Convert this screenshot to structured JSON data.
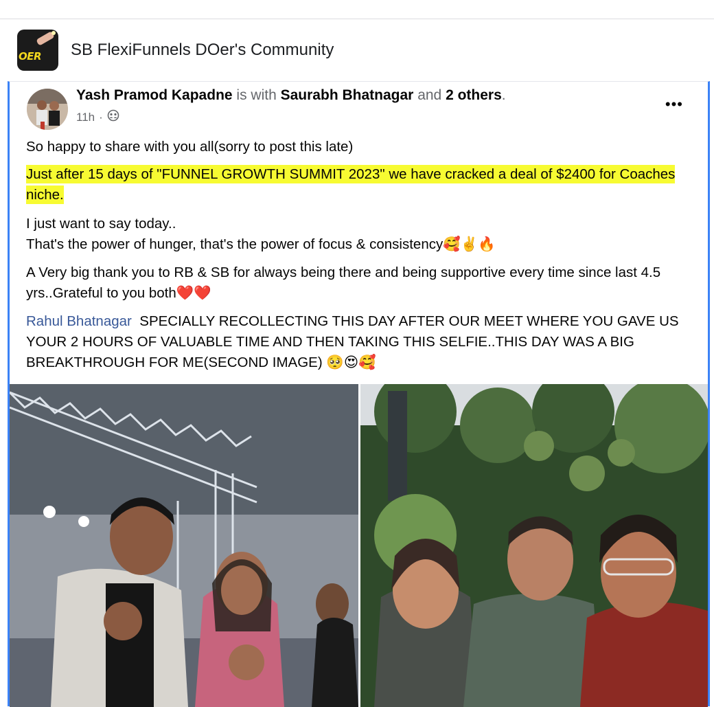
{
  "group": {
    "name": "SB FlexiFunnels DOer's Community",
    "logo_text": "OER"
  },
  "post": {
    "author": "Yash Pramod Kapadne",
    "with_text": "is with",
    "tagged_person": "Saurabh Bhatnagar",
    "and_text": "and",
    "others": "2 others",
    "period": ".",
    "time": "11h",
    "separator": "·",
    "privacy_icon": "group-audience-icon",
    "more_label": "•••",
    "lines": {
      "p1": "So happy to share with you all(sorry to post this late)",
      "p2": "Just after 15 days of \"FUNNEL GROWTH SUMMIT 2023\" we have cracked a deal of $2400 for Coaches niche.",
      "p3a": "I just want to say today..",
      "p3b": "That's the power of hunger, that's the power of focus & consistency",
      "p3b_emoji": "🥰✌️🔥",
      "p4": "A Very big thank you to RB & SB for always being there and being supportive every time since last 4.5 yrs..Grateful to you both",
      "p4_emoji": "❤️❤️",
      "mention": "Rahul Bhatnagar",
      "p5": "SPECIALLY RECOLLECTING THIS DAY AFTER OUR MEET WHERE YOU GAVE US YOUR 2 HOURS OF VALUABLE TIME AND THEN TAKING THIS SELFIE..THIS DAY WAS A BIG BREAKTHROUGH FOR ME(SECOND IMAGE)",
      "p5_emoji": "🥺😍🥰"
    }
  },
  "colors": {
    "highlight": "#f7fb32",
    "link": "#385898",
    "border_accent": "#3b82f6"
  }
}
